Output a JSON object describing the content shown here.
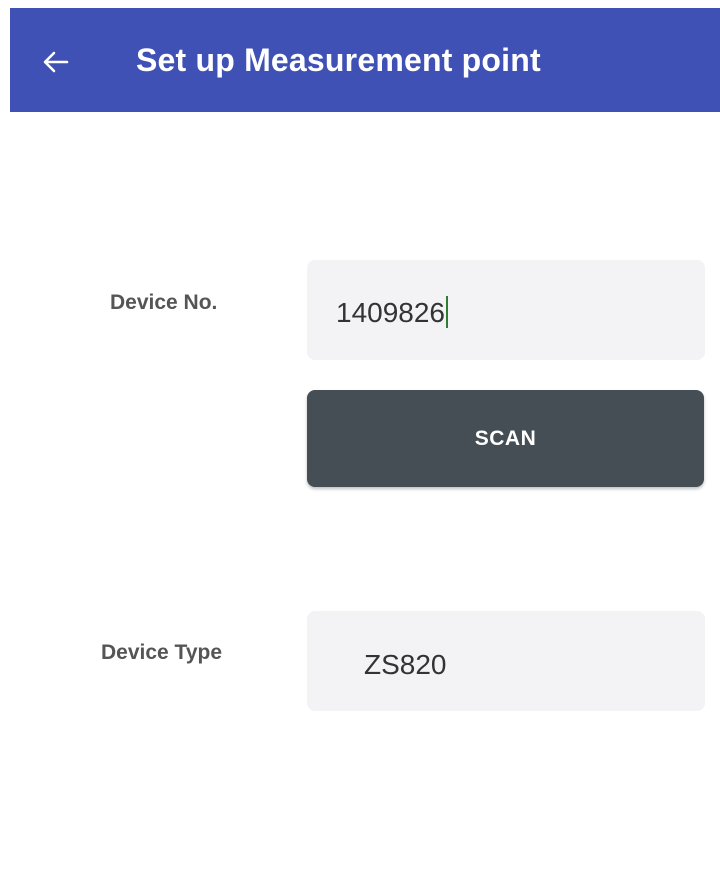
{
  "app_bar": {
    "title": "Set up Measurement point",
    "back_icon": "arrow-left-icon",
    "background_color": "#3f51b5"
  },
  "form": {
    "device_no": {
      "label": "Device No.",
      "value": "1409826"
    },
    "scan_button": {
      "label": "SCAN",
      "background_color": "#454d55"
    },
    "device_type": {
      "label": "Device Type",
      "value": "ZS820"
    }
  }
}
